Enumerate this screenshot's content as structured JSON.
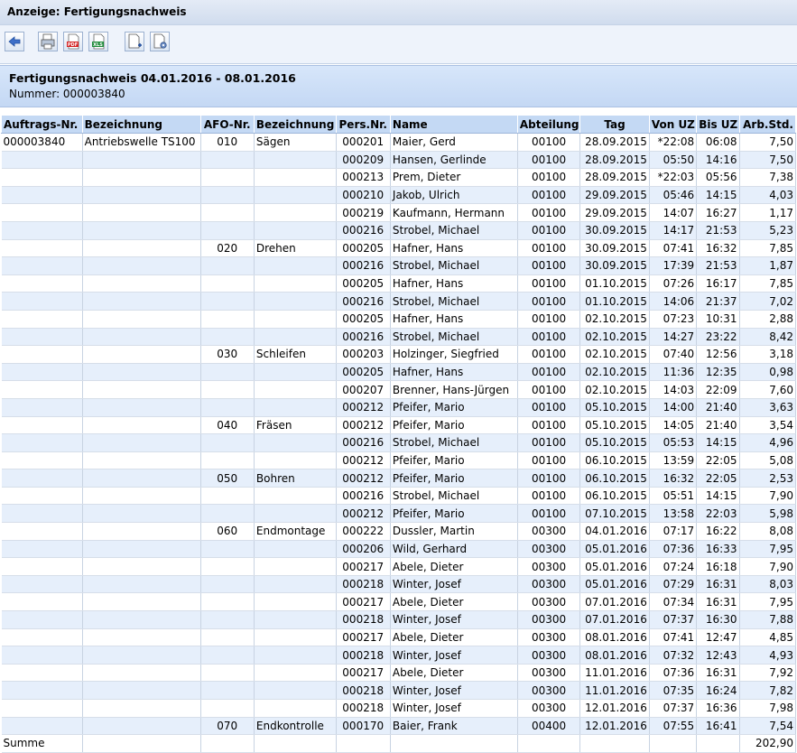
{
  "window": {
    "title": "Anzeige: Fertigungsnachweis"
  },
  "toolbar": {
    "buttons": [
      {
        "name": "back-button",
        "icon": "arrow-left-icon"
      },
      {
        "name": "print-button",
        "icon": "printer-icon"
      },
      {
        "name": "pdf-export-button",
        "icon": "pdf-icon"
      },
      {
        "name": "xls-export-button",
        "icon": "xls-icon"
      },
      {
        "name": "new-document-button",
        "icon": "new-document-icon"
      },
      {
        "name": "document-settings-button",
        "icon": "document-gear-icon"
      }
    ]
  },
  "header": {
    "title": "Fertigungsnachweis 04.01.2016 - 08.01.2016",
    "number_line": "Nummer: 000003840"
  },
  "table": {
    "columns": [
      "Auftrags-Nr.",
      "Bezeichnung",
      "AFO-Nr.",
      "Bezeichnung",
      "Pers.Nr.",
      "Name",
      "Abteilung",
      "Tag",
      "Von UZ",
      "Bis UZ",
      "Arb.Std."
    ],
    "rows": [
      [
        "000003840",
        "Antriebswelle TS100",
        "010",
        "Sägen",
        "000201",
        "Maier, Gerd",
        "00100",
        "28.09.2015",
        "*22:08",
        "06:08",
        "7,50"
      ],
      [
        "",
        "",
        "",
        "",
        "000209",
        "Hansen, Gerlinde",
        "00100",
        "28.09.2015",
        "05:50",
        "14:16",
        "7,50"
      ],
      [
        "",
        "",
        "",
        "",
        "000213",
        "Prem, Dieter",
        "00100",
        "28.09.2015",
        "*22:03",
        "05:56",
        "7,38"
      ],
      [
        "",
        "",
        "",
        "",
        "000210",
        "Jakob, Ulrich",
        "00100",
        "29.09.2015",
        "05:46",
        "14:15",
        "4,03"
      ],
      [
        "",
        "",
        "",
        "",
        "000219",
        "Kaufmann, Hermann",
        "00100",
        "29.09.2015",
        "14:07",
        "16:27",
        "1,17"
      ],
      [
        "",
        "",
        "",
        "",
        "000216",
        "Strobel, Michael",
        "00100",
        "30.09.2015",
        "14:17",
        "21:53",
        "5,23"
      ],
      [
        "",
        "",
        "020",
        "Drehen",
        "000205",
        "Hafner, Hans",
        "00100",
        "30.09.2015",
        "07:41",
        "16:32",
        "7,85"
      ],
      [
        "",
        "",
        "",
        "",
        "000216",
        "Strobel, Michael",
        "00100",
        "30.09.2015",
        "17:39",
        "21:53",
        "1,87"
      ],
      [
        "",
        "",
        "",
        "",
        "000205",
        "Hafner, Hans",
        "00100",
        "01.10.2015",
        "07:26",
        "16:17",
        "7,85"
      ],
      [
        "",
        "",
        "",
        "",
        "000216",
        "Strobel, Michael",
        "00100",
        "01.10.2015",
        "14:06",
        "21:37",
        "7,02"
      ],
      [
        "",
        "",
        "",
        "",
        "000205",
        "Hafner, Hans",
        "00100",
        "02.10.2015",
        "07:23",
        "10:31",
        "2,88"
      ],
      [
        "",
        "",
        "",
        "",
        "000216",
        "Strobel, Michael",
        "00100",
        "02.10.2015",
        "14:27",
        "23:22",
        "8,42"
      ],
      [
        "",
        "",
        "030",
        "Schleifen",
        "000203",
        "Holzinger, Siegfried",
        "00100",
        "02.10.2015",
        "07:40",
        "12:56",
        "3,18"
      ],
      [
        "",
        "",
        "",
        "",
        "000205",
        "Hafner, Hans",
        "00100",
        "02.10.2015",
        "11:36",
        "12:35",
        "0,98"
      ],
      [
        "",
        "",
        "",
        "",
        "000207",
        "Brenner, Hans-Jürgen",
        "00100",
        "02.10.2015",
        "14:03",
        "22:09",
        "7,60"
      ],
      [
        "",
        "",
        "",
        "",
        "000212",
        "Pfeifer, Mario",
        "00100",
        "05.10.2015",
        "14:00",
        "21:40",
        "3,63"
      ],
      [
        "",
        "",
        "040",
        "Fräsen",
        "000212",
        "Pfeifer, Mario",
        "00100",
        "05.10.2015",
        "14:05",
        "21:40",
        "3,54"
      ],
      [
        "",
        "",
        "",
        "",
        "000216",
        "Strobel, Michael",
        "00100",
        "05.10.2015",
        "05:53",
        "14:15",
        "4,96"
      ],
      [
        "",
        "",
        "",
        "",
        "000212",
        "Pfeifer, Mario",
        "00100",
        "06.10.2015",
        "13:59",
        "22:05",
        "5,08"
      ],
      [
        "",
        "",
        "050",
        "Bohren",
        "000212",
        "Pfeifer, Mario",
        "00100",
        "06.10.2015",
        "16:32",
        "22:05",
        "2,53"
      ],
      [
        "",
        "",
        "",
        "",
        "000216",
        "Strobel, Michael",
        "00100",
        "06.10.2015",
        "05:51",
        "14:15",
        "7,90"
      ],
      [
        "",
        "",
        "",
        "",
        "000212",
        "Pfeifer, Mario",
        "00100",
        "07.10.2015",
        "13:58",
        "22:03",
        "5,98"
      ],
      [
        "",
        "",
        "060",
        "Endmontage",
        "000222",
        "Dussler, Martin",
        "00300",
        "04.01.2016",
        "07:17",
        "16:22",
        "8,08"
      ],
      [
        "",
        "",
        "",
        "",
        "000206",
        "Wild, Gerhard",
        "00300",
        "05.01.2016",
        "07:36",
        "16:33",
        "7,95"
      ],
      [
        "",
        "",
        "",
        "",
        "000217",
        "Abele, Dieter",
        "00300",
        "05.01.2016",
        "07:24",
        "16:18",
        "7,90"
      ],
      [
        "",
        "",
        "",
        "",
        "000218",
        "Winter, Josef",
        "00300",
        "05.01.2016",
        "07:29",
        "16:31",
        "8,03"
      ],
      [
        "",
        "",
        "",
        "",
        "000217",
        "Abele, Dieter",
        "00300",
        "07.01.2016",
        "07:34",
        "16:31",
        "7,95"
      ],
      [
        "",
        "",
        "",
        "",
        "000218",
        "Winter, Josef",
        "00300",
        "07.01.2016",
        "07:37",
        "16:30",
        "7,88"
      ],
      [
        "",
        "",
        "",
        "",
        "000217",
        "Abele, Dieter",
        "00300",
        "08.01.2016",
        "07:41",
        "12:47",
        "4,85"
      ],
      [
        "",
        "",
        "",
        "",
        "000218",
        "Winter, Josef",
        "00300",
        "08.01.2016",
        "07:32",
        "12:43",
        "4,93"
      ],
      [
        "",
        "",
        "",
        "",
        "000217",
        "Abele, Dieter",
        "00300",
        "11.01.2016",
        "07:36",
        "16:31",
        "7,92"
      ],
      [
        "",
        "",
        "",
        "",
        "000218",
        "Winter, Josef",
        "00300",
        "11.01.2016",
        "07:35",
        "16:24",
        "7,82"
      ],
      [
        "",
        "",
        "",
        "",
        "000218",
        "Winter, Josef",
        "00300",
        "12.01.2016",
        "07:37",
        "16:36",
        "7,98"
      ],
      [
        "",
        "",
        "070",
        "Endkontrolle",
        "000170",
        "Baier, Frank",
        "00400",
        "12.01.2016",
        "07:55",
        "16:41",
        "7,54"
      ]
    ],
    "summary": {
      "label": "Summe",
      "total": "202,90"
    }
  }
}
